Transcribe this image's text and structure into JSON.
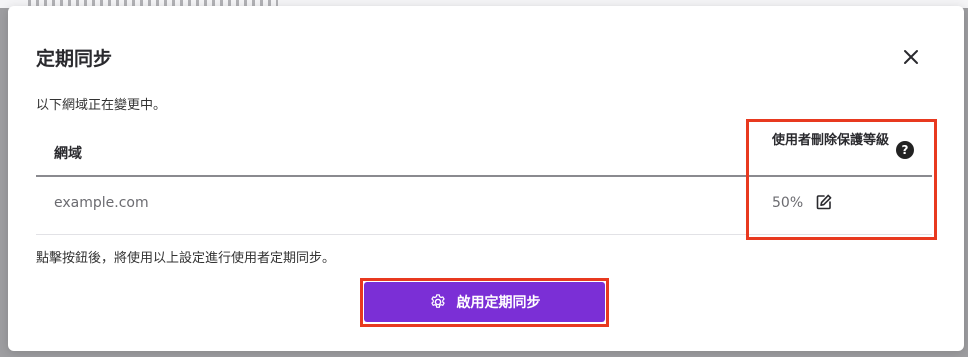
{
  "dialog": {
    "title": "定期同步",
    "close_icon": "close-icon",
    "description": "以下網域正在變更中。",
    "table": {
      "headers": [
        "網域",
        "使用者刪除保護等級"
      ],
      "rows": [
        {
          "domain": "example.com",
          "protection_level": "50%"
        }
      ]
    },
    "note": "點擊按鈕後，將使用以上設定進行使用者定期同步。",
    "primary_button": {
      "label": "啟用定期同步",
      "icon": "gear-icon"
    },
    "help_icon_glyph": "?"
  },
  "colors": {
    "primary": "#7b2fd6",
    "highlight": "#e8391f",
    "overlay": "#9e9ea1"
  }
}
